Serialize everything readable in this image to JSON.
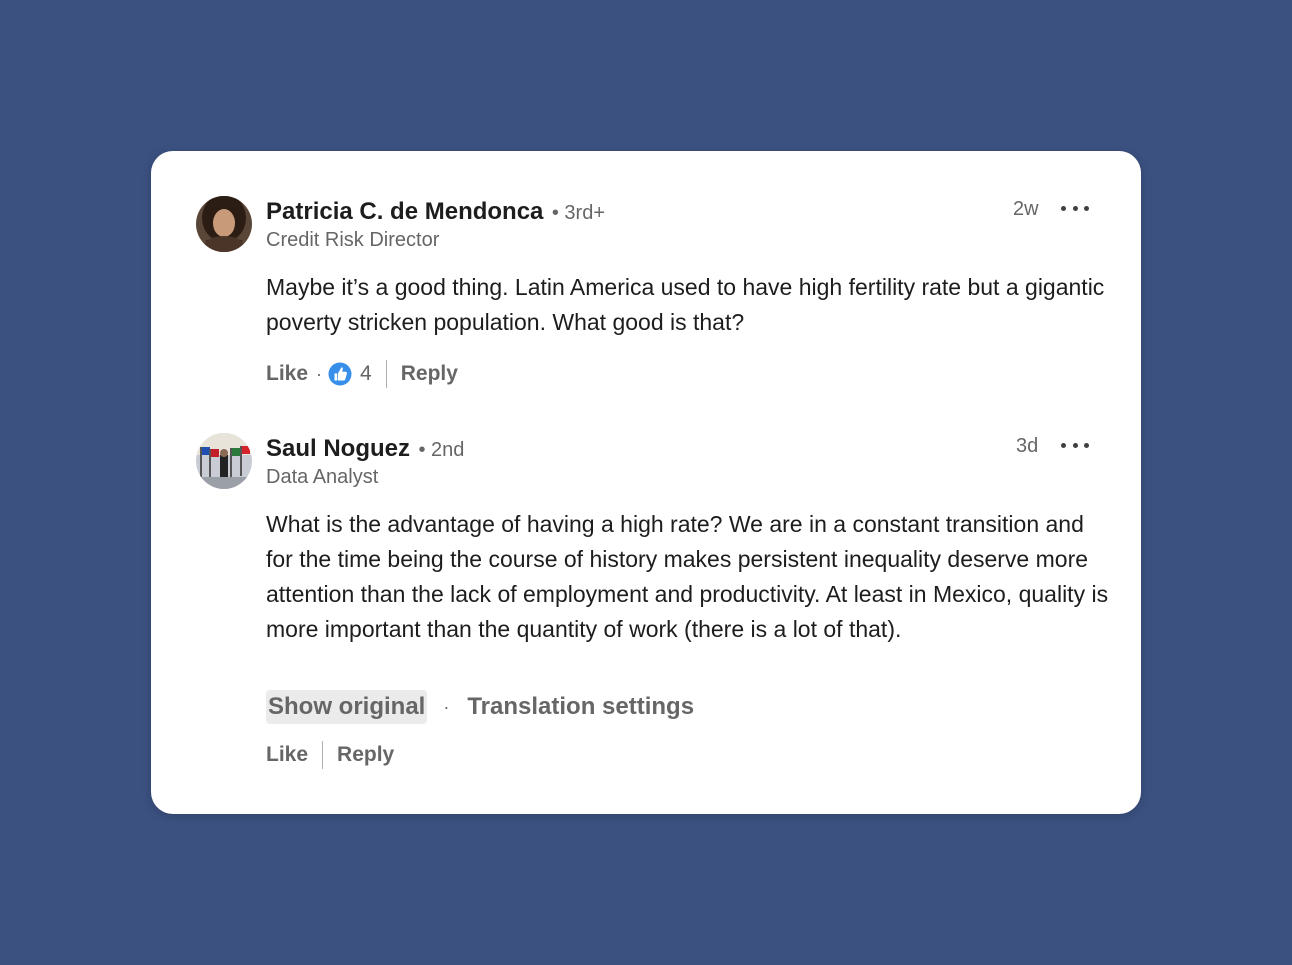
{
  "comments": [
    {
      "author": "Patricia C. de Mendonca",
      "degree": "• 3rd+",
      "headline": "Credit Risk Director",
      "time": "2w",
      "more_icon": "ellipsis-icon",
      "text": "Maybe it’s a good thing. Latin America used to have high fertility rate but a gigantic poverty stricken population. What good is that?",
      "like_label": "Like",
      "dot": "·",
      "reaction_icon": "thumbs-up-icon",
      "reaction_count": "4",
      "reply_label": "Reply"
    },
    {
      "author": "Saul Noguez",
      "degree": "• 2nd",
      "headline": "Data Analyst",
      "time": "3d",
      "more_icon": "ellipsis-icon",
      "text": "What is the advantage of having a high rate? We are in a constant transition and for the time being the course of history makes persistent inequality deserve more attention than the lack of employment and productivity. At least in Mexico, quality is more important than the quantity of work (there is a lot of that).",
      "show_original_label": "Show original",
      "translate_dot": "·",
      "translation_settings_label": "Translation settings",
      "like_label": "Like",
      "reply_label": "Reply"
    }
  ],
  "colors": {
    "background": "#3b5180",
    "card": "#ffffff",
    "reaction_blue": "#378fe9"
  }
}
